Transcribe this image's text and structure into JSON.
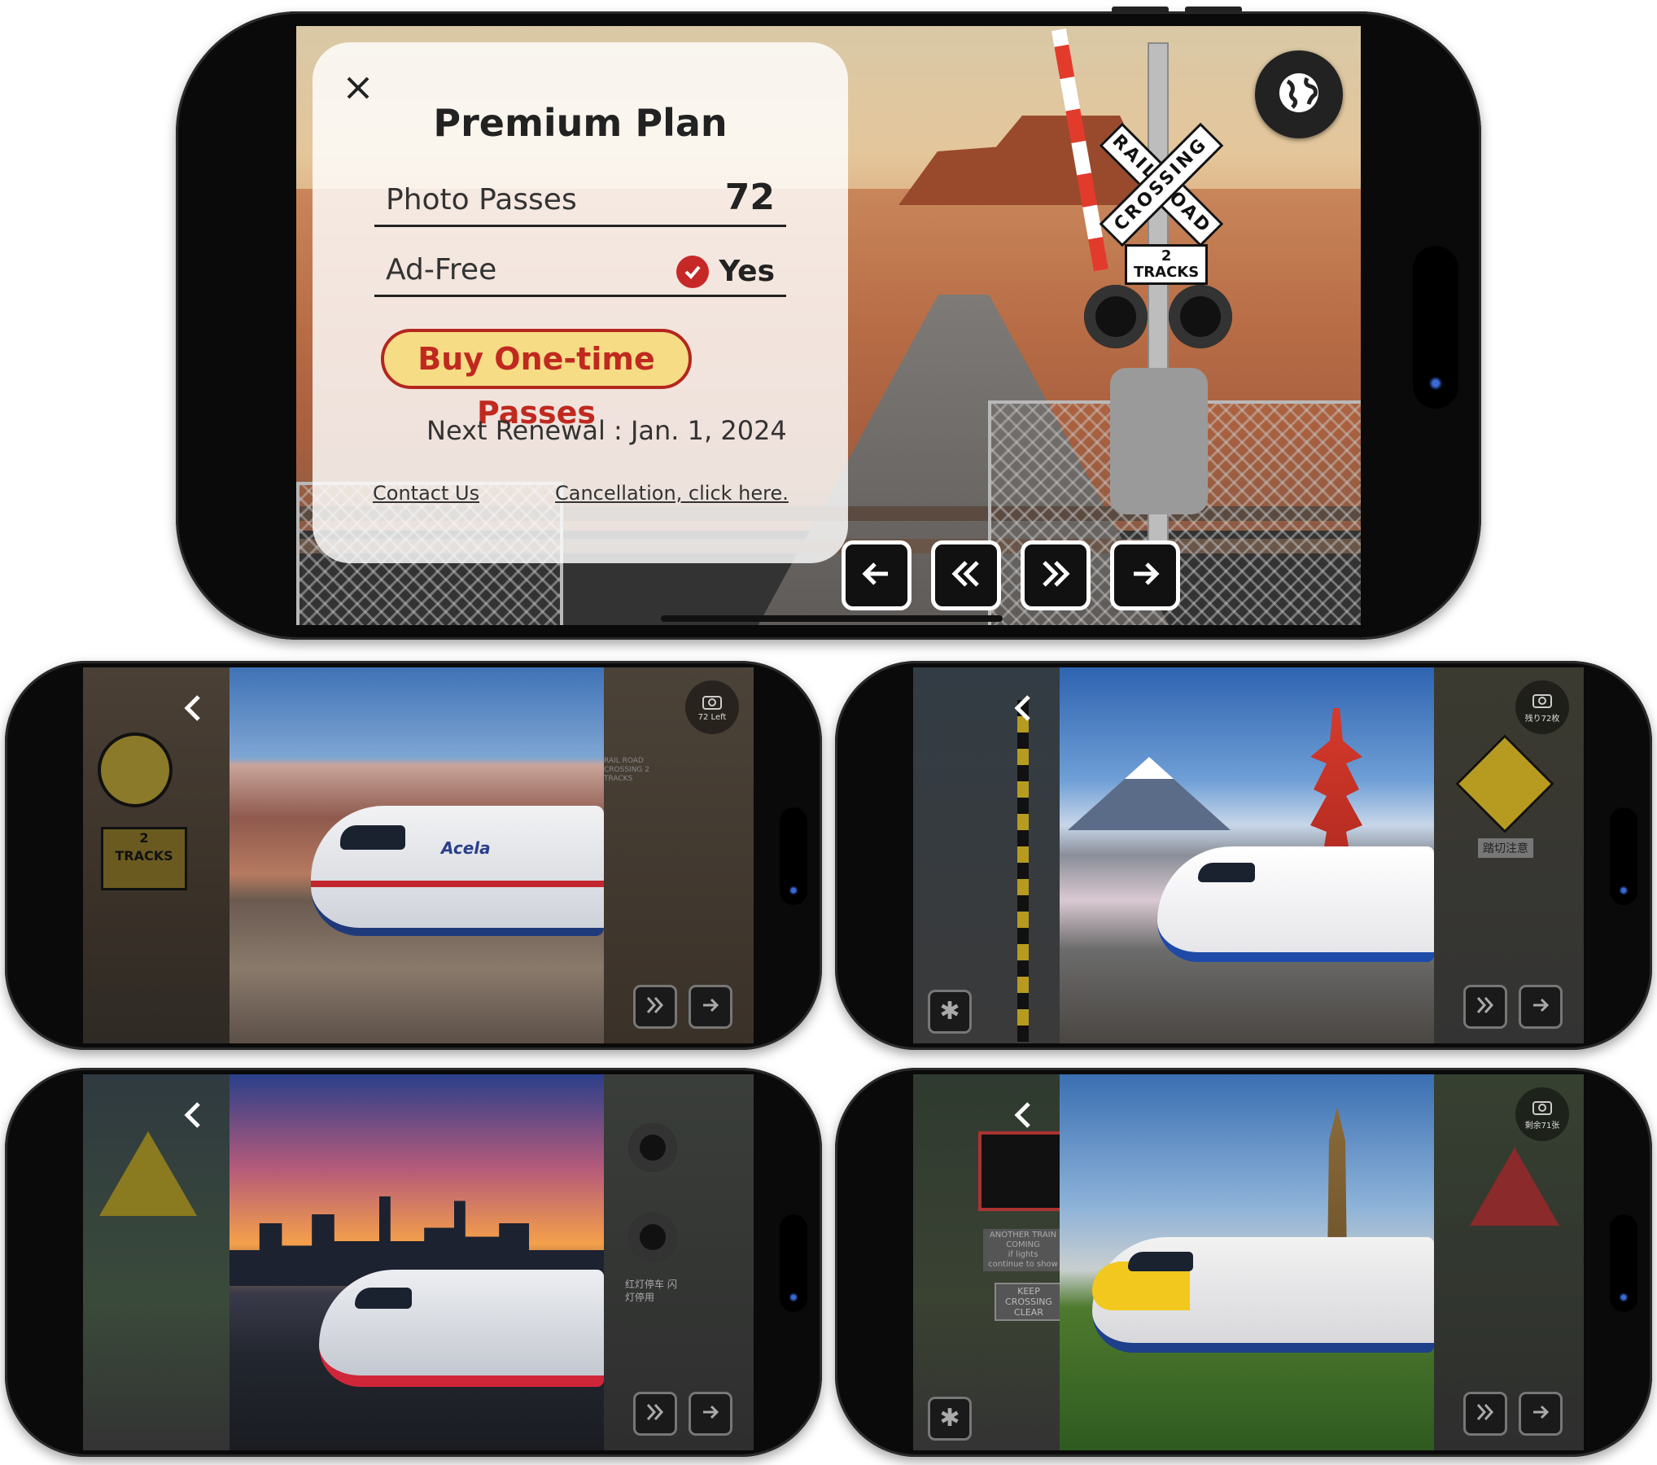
{
  "main_screen": {
    "panel": {
      "title": "Premium Plan",
      "photo_passes_label": "Photo Passes",
      "photo_passes_value": "72",
      "ad_free_label": "Ad-Free",
      "ad_free_value": "Yes",
      "buy_button": "Buy One-time Passes",
      "renewal": "Next Renewal : Jan. 1, 2024",
      "contact_link": "Contact Us",
      "cancel_link": "Cancellation, click here."
    },
    "scene_sign": {
      "crossbuck_top": "RAIL ROAD",
      "crossbuck_bottom": "CROSSING",
      "tracks_number": "2",
      "tracks_label": "TRACKS"
    },
    "nav_icons": [
      "arrow-left-icon",
      "rewind-icon",
      "fast-forward-icon",
      "arrow-right-icon"
    ]
  },
  "photo_screens": [
    {
      "scene": "grand-canyon",
      "train_text": "Acela",
      "sign_number": "2",
      "sign_label": "TRACKS",
      "camera_badge": "72 Left",
      "overlay_text": "RAIL ROAD CROSSING 2 TRACKS"
    },
    {
      "scene": "mount-fuji",
      "camera_badge": "残り72枚",
      "sign_text": "踏切注意"
    },
    {
      "scene": "shanghai-skyline",
      "sign_text": "红灯停车 闪灯停用"
    },
    {
      "scene": "big-ben",
      "camera_badge": "剩余71张",
      "sign_lines": [
        "ANOTHER TRAIN",
        "COMING",
        "if lights",
        "continue to show"
      ],
      "keep_clear_lines": [
        "KEEP",
        "CROSSING",
        "CLEAR"
      ]
    }
  ],
  "colors": {
    "accent_red": "#c0291f",
    "buy_button_fill": "#f6dc85",
    "phone_frame": "#0a0a0a"
  }
}
